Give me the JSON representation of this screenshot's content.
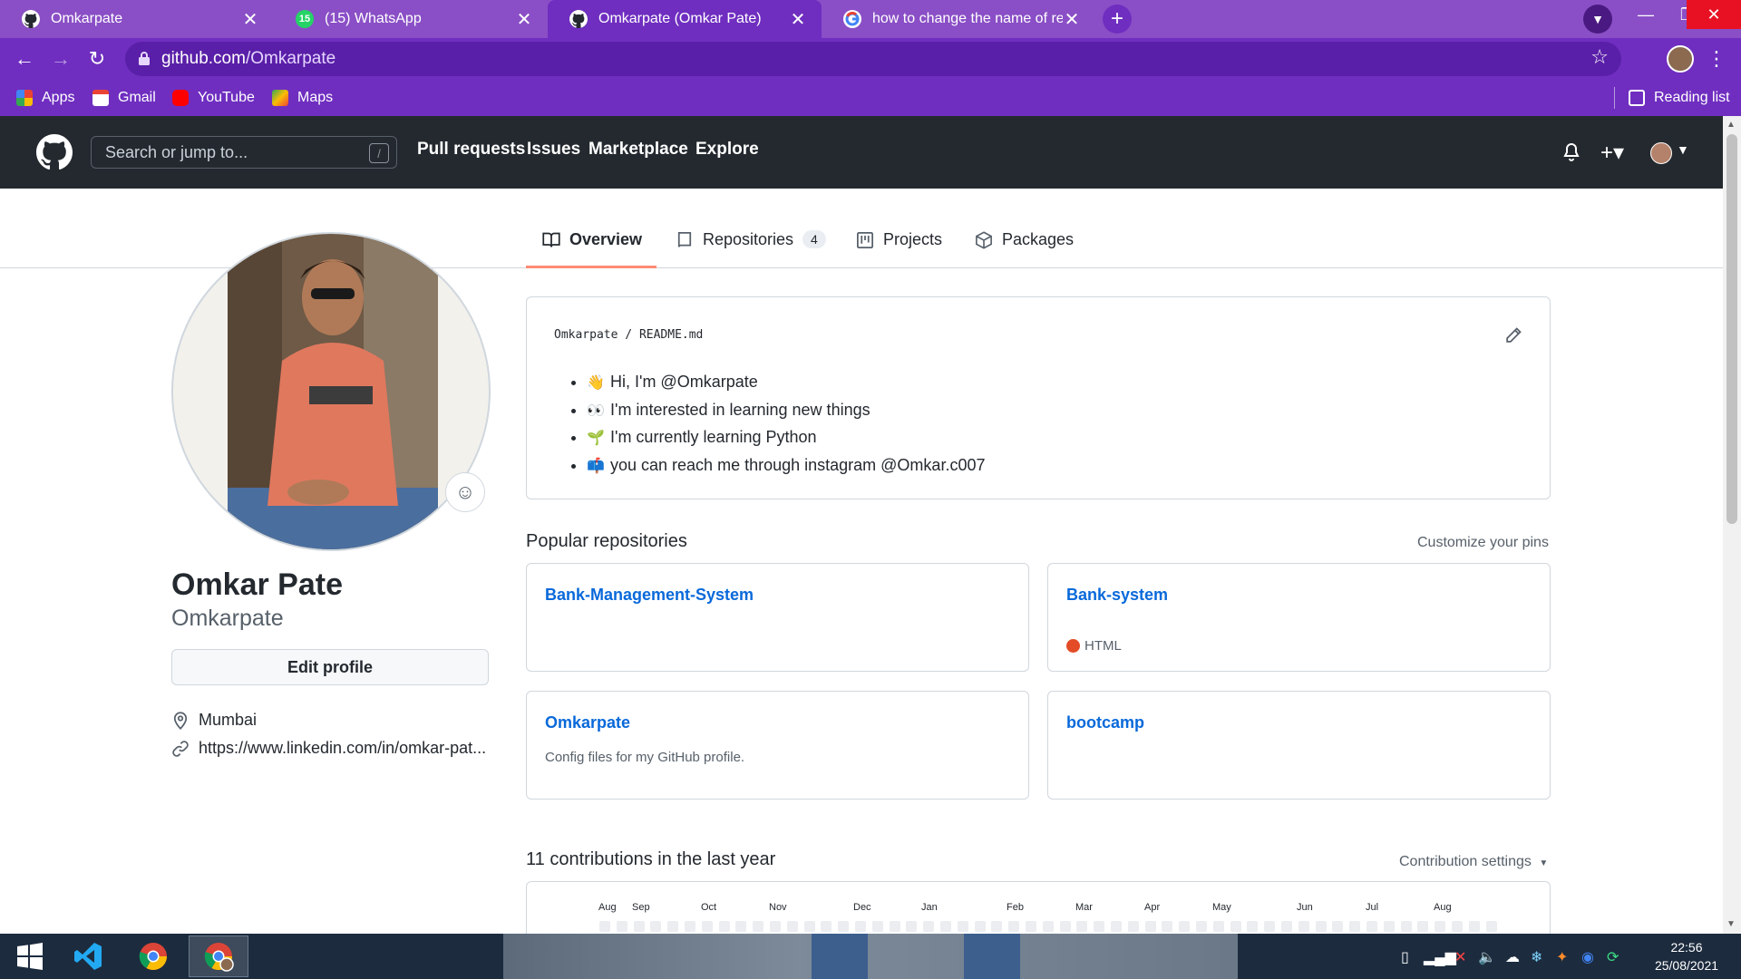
{
  "browser": {
    "tabs": [
      {
        "title": "Omkarpate",
        "icon": "github-icon"
      },
      {
        "title": "(15) WhatsApp",
        "icon": "whatsapp-icon",
        "badge": "15"
      },
      {
        "title": "Omkarpate (Omkar Pate)",
        "icon": "github-icon"
      },
      {
        "title": "how to change the name of repo",
        "icon": "google-icon"
      }
    ],
    "active_tab": 2,
    "url_host": "github.com",
    "url_path": "/Omkarpate",
    "bookmarks": [
      "Apps",
      "Gmail",
      "YouTube",
      "Maps"
    ],
    "reading_list": "Reading list",
    "colors": {
      "frame": "#8a4fc6",
      "toolbar": "#6f2ec0"
    }
  },
  "github": {
    "search_placeholder": "Search or jump to...",
    "search_key": "/",
    "nav": [
      "Pull requests",
      "Issues",
      "Marketplace",
      "Explore"
    ],
    "profile_tabs": [
      {
        "label": "Overview",
        "icon": "book-icon"
      },
      {
        "label": "Repositories",
        "icon": "repo-icon",
        "count": "4"
      },
      {
        "label": "Projects",
        "icon": "project-icon"
      },
      {
        "label": "Packages",
        "icon": "package-icon"
      }
    ],
    "profile": {
      "full_name": "Omkar Pate",
      "username": "Omkarpate",
      "edit_button": "Edit profile",
      "location": "Mumbai",
      "website": "https://www.linkedin.com/in/omkar-pat..."
    },
    "readme": {
      "owner": "Omkarpate",
      "separator": "/",
      "file": "README.md",
      "items": [
        {
          "emoji": "👋",
          "text": "Hi, I'm @Omkarpate"
        },
        {
          "emoji": "👀",
          "text": "I'm interested in learning new things"
        },
        {
          "emoji": "🌱",
          "text": "I'm currently learning Python"
        },
        {
          "emoji": "📫",
          "text": "you can reach me through instagram @Omkar.c007"
        }
      ]
    },
    "popular": {
      "title": "Popular repositories",
      "customize": "Customize your pins",
      "repos": [
        {
          "name": "Bank-Management-System",
          "description": "",
          "language": ""
        },
        {
          "name": "Bank-system",
          "description": "",
          "language": "HTML"
        },
        {
          "name": "Omkarpate",
          "description": "Config files for my GitHub profile.",
          "language": ""
        },
        {
          "name": "bootcamp",
          "description": "",
          "language": ""
        }
      ]
    },
    "contributions": {
      "title": "11 contributions in the last year",
      "settings": "Contribution settings",
      "months": [
        "Aug",
        "Sep",
        "Oct",
        "Nov",
        "Dec",
        "Jan",
        "Feb",
        "Mar",
        "Apr",
        "May",
        "Jun",
        "Jul",
        "Aug"
      ]
    }
  },
  "taskbar": {
    "time": "22:56",
    "date": "25/08/2021"
  }
}
